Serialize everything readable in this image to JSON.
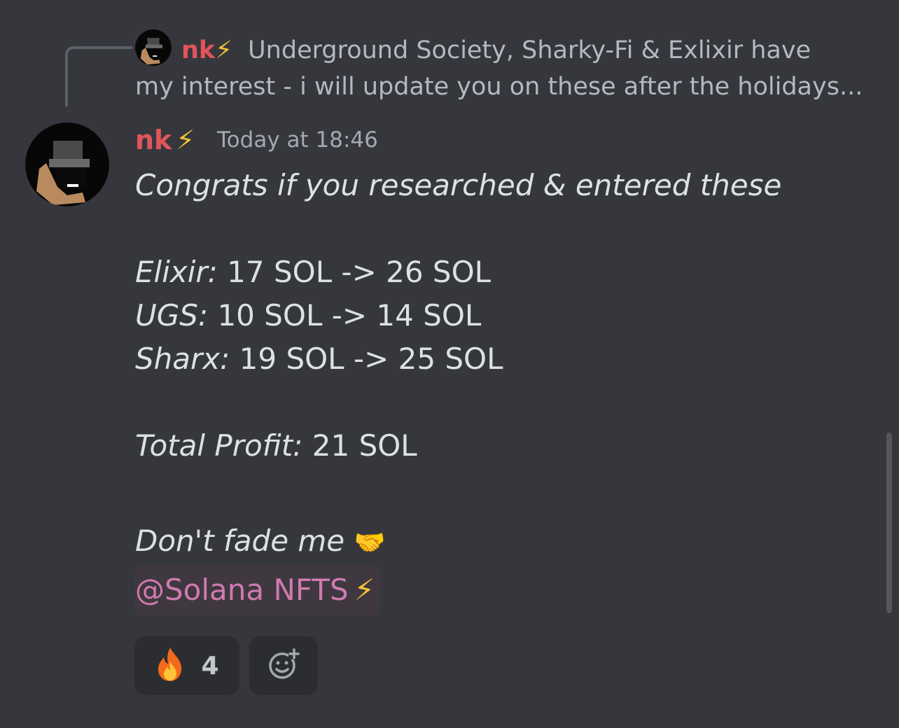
{
  "reply": {
    "author": "nk",
    "author_badge": "⚡",
    "text_line1": "Underground Society, Sharky-Fi & Exlixir  have",
    "text_line2": "my interest - i will update you on these after the holidays..."
  },
  "message": {
    "author": "nk",
    "author_badge": "⚡",
    "timestamp": "Today at 18:46",
    "intro": "Congrats if you researched & entered these",
    "trades": [
      {
        "label": "Elixir:",
        "value": " 17 SOL -> 26 SOL"
      },
      {
        "label": "UGS:",
        "value": " 10 SOL -> 14 SOL"
      },
      {
        "label": "Sharx:",
        "value": " 19 SOL -> 25 SOL"
      }
    ],
    "total_label": "Total Profit:",
    "total_value": " 21 SOL",
    "closing": "Don't fade me",
    "closing_emoji": "🤝",
    "mention": "@Solana NFTS",
    "mention_badge": "⚡"
  },
  "reactions": [
    {
      "emoji": "fire-emoji",
      "count": "4"
    },
    {
      "emoji": "add-reaction-icon",
      "count": ""
    }
  ],
  "colors": {
    "background": "#36373d",
    "author": "#e0555b",
    "mention_text": "#d07ab0",
    "mention_bg": "#3f3840",
    "reaction_bg": "#2b2d31"
  }
}
